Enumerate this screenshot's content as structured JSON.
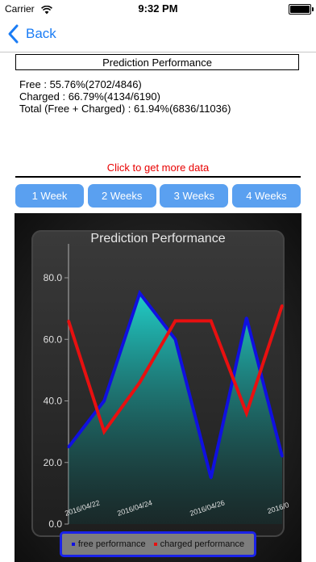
{
  "status": {
    "carrier": "Carrier",
    "time": "9:32 PM"
  },
  "nav": {
    "back_label": "Back"
  },
  "summary": {
    "title": "Prediction Performance",
    "free": "Free : 55.76%(2702/4846)",
    "charged": "Charged : 66.79%(4134/6190)",
    "total": "Total (Free + Charged) : 61.94%(6836/11036)"
  },
  "more_data_label": "Click to get more data",
  "week_buttons": [
    "1 Week",
    "2 Weeks",
    "3 Weeks",
    "4 Weeks"
  ],
  "colors": {
    "accent": "#1a7cf5",
    "button": "#5aa0f0",
    "free": "#1010e0",
    "charged": "#e81010",
    "link": "#e80000"
  },
  "chart_data": {
    "type": "line",
    "title": "Prediction Performance",
    "ylim": [
      0,
      80
    ],
    "yticks": [
      "0.0",
      "20.0",
      "40.0",
      "60.0",
      "80.0"
    ],
    "x": [
      0,
      1,
      2,
      3,
      4,
      5,
      6,
      7
    ],
    "xticks": [
      "2016/04/22",
      "2016/04/24",
      "2016/04/26",
      "2016/0"
    ],
    "series": [
      {
        "name": "free performance",
        "color": "#1010e0",
        "values": [
          25,
          40,
          75,
          60,
          15,
          67,
          22
        ]
      },
      {
        "name": "charged performance",
        "color": "#e81010",
        "values": [
          66,
          30,
          46,
          66,
          66,
          36,
          71
        ]
      }
    ],
    "legend_position": "bottom",
    "grid": false
  }
}
